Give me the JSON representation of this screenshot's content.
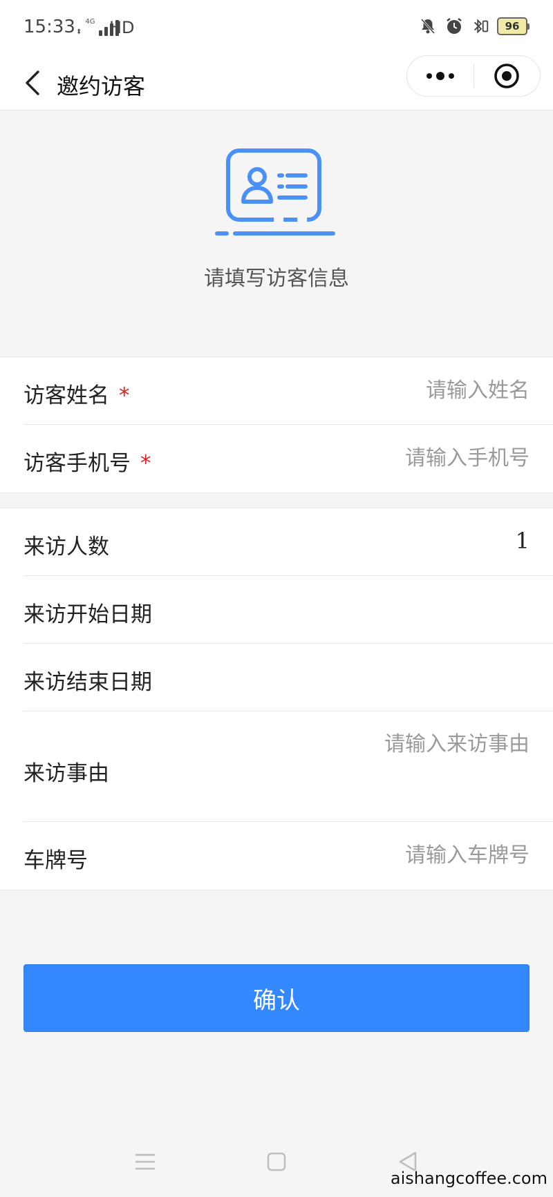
{
  "status_bar": {
    "time": "15:33",
    "network": "4G",
    "hd": "HD",
    "battery": "96"
  },
  "nav": {
    "title": "邀约访客",
    "icons": {
      "back": "chevron-left-icon",
      "more": "more-dots-icon",
      "close": "target-circle-icon"
    }
  },
  "hero": {
    "icon": "id-card-icon",
    "text": "请填写访客信息"
  },
  "form": {
    "name": {
      "label": "访客姓名",
      "required_mark": "*",
      "placeholder": "请输入姓名"
    },
    "phone": {
      "label": "访客手机号",
      "required_mark": "*",
      "placeholder": "请输入手机号"
    },
    "count": {
      "label": "来访人数",
      "value": "1"
    },
    "start_date": {
      "label": "来访开始日期"
    },
    "end_date": {
      "label": "来访结束日期"
    },
    "reason": {
      "label": "来访事由",
      "placeholder": "请输入来访事由"
    },
    "plate": {
      "label": "车牌号",
      "placeholder": "请输入车牌号"
    }
  },
  "confirm_label": "确认",
  "watermark": "aishangcoffee.com",
  "colors": {
    "primary": "#3388ff",
    "required": "#e02020",
    "background": "#f5f5f5"
  }
}
